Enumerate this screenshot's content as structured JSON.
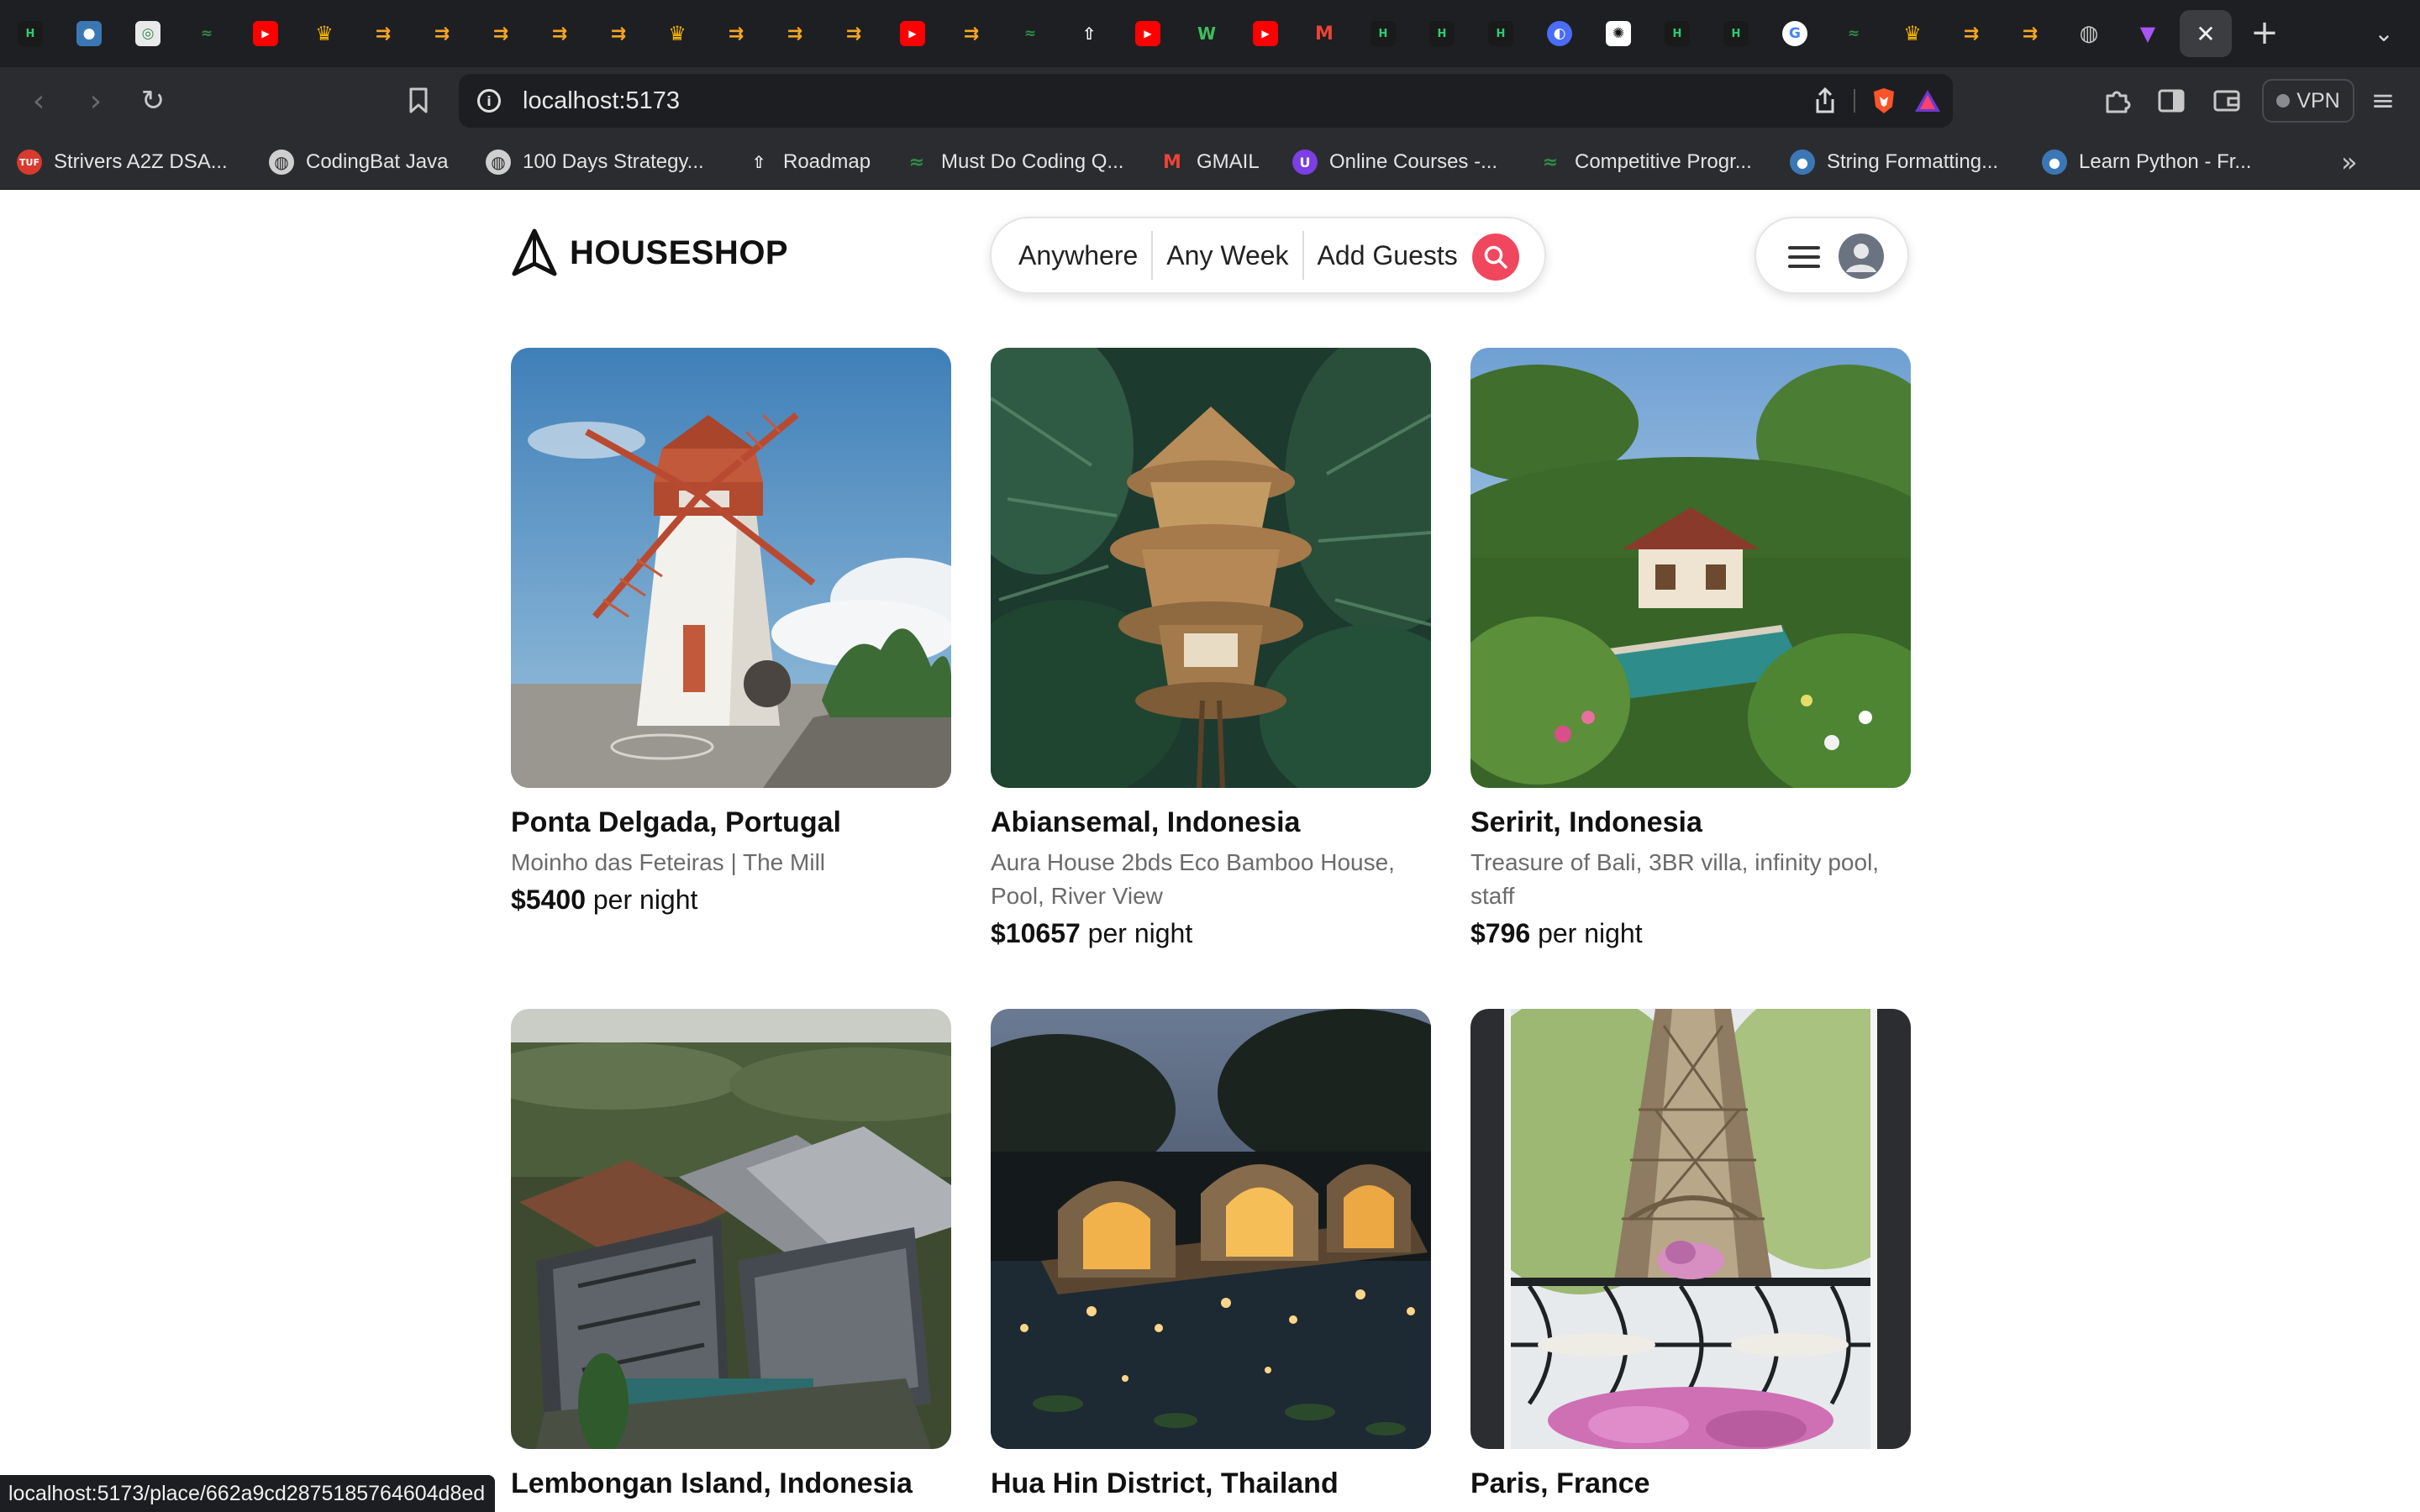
{
  "browser": {
    "url": "localhost:5173",
    "vpn_label": "VPN",
    "tab_favicons": [
      "H",
      "py",
      "ai",
      "gfg",
      "yt",
      "crown",
      "code",
      "code",
      "code",
      "code",
      "code",
      "crown",
      "code",
      "code",
      "code",
      "yt",
      "code",
      "gfg",
      "rocket",
      "yt",
      "W",
      "yt",
      "M",
      "H",
      "H",
      "H",
      "swirl",
      "gpt",
      "H",
      "H",
      "G",
      "gfg",
      "crown",
      "code",
      "code",
      "globe",
      "vite"
    ],
    "bookmarks": [
      {
        "label": "Strivers A2Z DSA...",
        "icon": "tuf-icon"
      },
      {
        "label": "CodingBat Java",
        "icon": "globe-icon"
      },
      {
        "label": "100 Days Strategy...",
        "icon": "globe-icon"
      },
      {
        "label": "Roadmap",
        "icon": "rocket-icon"
      },
      {
        "label": "Must Do Coding Q...",
        "icon": "gfg-icon"
      },
      {
        "label": "GMAIL",
        "icon": "gmail-icon"
      },
      {
        "label": "Online Courses -...",
        "icon": "udemy-icon"
      },
      {
        "label": "Competitive Progr...",
        "icon": "gfg-icon"
      },
      {
        "label": "String Formatting...",
        "icon": "python-icon"
      },
      {
        "label": "Learn Python - Fr...",
        "icon": "python-icon"
      }
    ],
    "status_url": "localhost:5173/place/662a9cd2875185764604d8ed"
  },
  "header": {
    "brand": "HOUSESHOP",
    "search": {
      "where": "Anywhere",
      "when": "Any Week",
      "who": "Add Guests"
    },
    "accent_color": "#f0475e"
  },
  "listings": [
    {
      "location": "Ponta Delgada, Portugal",
      "title": "Moinho das Feteiras | The Mill",
      "price": "$5400",
      "unit": "per night"
    },
    {
      "location": "Abiansemal, Indonesia",
      "title": "Aura House 2bds Eco Bamboo House, Pool, River View",
      "price": "$10657",
      "unit": "per night"
    },
    {
      "location": "Seririt, Indonesia",
      "title": "Treasure of Bali, 3BR villa, infinity pool, staff",
      "price": "$796",
      "unit": "per night"
    },
    {
      "location": "Lembongan Island, Indonesia",
      "title": "",
      "price": "",
      "unit": ""
    },
    {
      "location": "Hua Hin District, Thailand",
      "title": "",
      "price": "",
      "unit": ""
    },
    {
      "location": "Paris, France",
      "title": "",
      "price": "",
      "unit": ""
    }
  ]
}
